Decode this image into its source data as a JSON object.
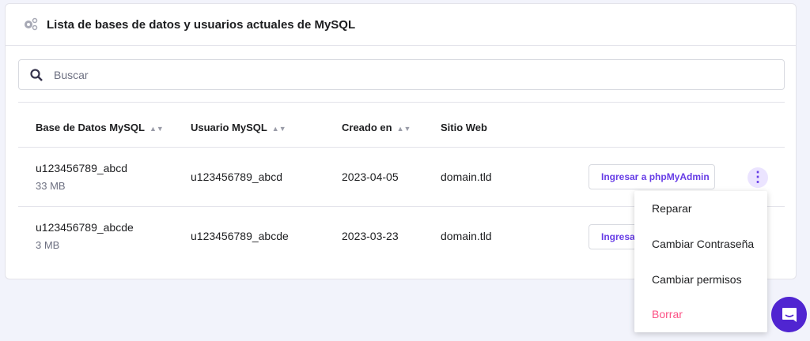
{
  "title": "Lista de bases de datos y usuarios actuales de MySQL",
  "search": {
    "placeholder": "Buscar",
    "value": ""
  },
  "columns": [
    "Base de Datos MySQL",
    "Usuario MySQL",
    "Creado en",
    "Sitio Web"
  ],
  "rows": [
    {
      "db": "u123456789_abcd",
      "size": "33 MB",
      "user": "u123456789_abcd",
      "created": "2023-04-05",
      "site": "domain.tld",
      "action": "Ingresar a phpMyAdmin"
    },
    {
      "db": "u123456789_abcde",
      "size": "3 MB",
      "user": "u123456789_abcde",
      "created": "2023-03-23",
      "site": "domain.tld",
      "action": "Ingresar a phpMyAdmin"
    }
  ],
  "menu": [
    "Reparar",
    "Cambiar Contraseña",
    "Cambiar permisos",
    "Borrar"
  ],
  "colors": {
    "accent": "#673de6",
    "danger": "#fc5185",
    "chat": "#5025d1"
  }
}
